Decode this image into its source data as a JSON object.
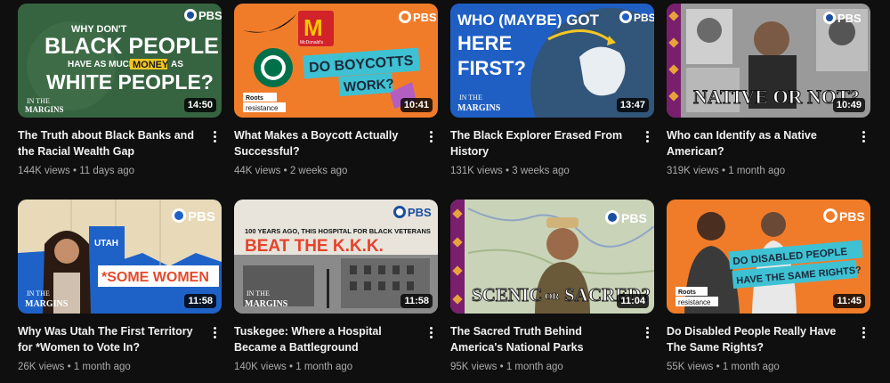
{
  "videos": [
    {
      "title": "The Truth about Black Banks and the Racial Wealth Gap",
      "info": "144K views • 11 days ago",
      "duration": "14:50",
      "thumb": {
        "pbs": "PBS",
        "line1": "WHY DON'T",
        "line2": "BLACK PEOPLE",
        "line3": "HAVE AS MUCH",
        "highlight": "MONEY",
        "line3b": "AS",
        "line4": "WHITE PEOPLE?",
        "brand1": "IN THE",
        "brand2": "MARGINS"
      }
    },
    {
      "title": "What Makes a Boycott Actually Successful?",
      "info": "44K views • 2 weeks ago",
      "duration": "10:41",
      "thumb": {
        "pbs": "PBS",
        "line1": "DO BOYCOTTS",
        "line2": "WORK?",
        "brand1": "Roots",
        "brand2": "resistance",
        "logo1": "McDonald's",
        "logo2": "STARBUCKS COFFEE"
      }
    },
    {
      "title": "The Black Explorer Erased From History",
      "info": "131K views • 3 weeks ago",
      "duration": "13:47",
      "thumb": {
        "pbs": "PBS",
        "line1": "WHO (MAYBE) GOT",
        "line2": "HERE",
        "line3": "FIRST?",
        "brand1": "IN THE",
        "brand2": "MARGINS"
      }
    },
    {
      "title": "Who can Identify as a Native American?",
      "info": "319K views • 1 month ago",
      "duration": "10:49",
      "thumb": {
        "pbs": "PBS",
        "line1": "NATIVE OR NOT?"
      }
    },
    {
      "title": "Why Was Utah The First Territory for *Women to Vote In?",
      "info": "26K views • 1 month ago",
      "duration": "11:58",
      "thumb": {
        "pbs": "PBS",
        "state": "UTAH",
        "line1": "*SOME WOMEN",
        "brand1": "IN THE",
        "brand2": "MARGINS"
      }
    },
    {
      "title": "Tuskegee: Where a Hospital Became a Battleground",
      "info": "140K views • 1 month ago",
      "duration": "11:58",
      "thumb": {
        "pbs": "PBS",
        "line1": "100 YEARS AGO, THIS HOSPITAL FOR BLACK VETERANS",
        "line2": "BEAT THE K.K.K.",
        "brand1": "IN THE",
        "brand2": "MARGINS"
      }
    },
    {
      "title": "The Sacred Truth Behind America's National Parks",
      "info": "95K views • 1 month ago",
      "duration": "11:04",
      "thumb": {
        "pbs": "PBS",
        "line1": "SCENIC",
        "line1b": "OR",
        "line2": "SACRED?"
      }
    },
    {
      "title": "Do Disabled People Really Have The Same Rights?",
      "info": "55K views • 1 month ago",
      "duration": "11:45",
      "thumb": {
        "pbs": "PBS",
        "line1": "DO DISABLED PEOPLE",
        "line2": "HAVE THE SAME RIGHTS?",
        "brand1": "Roots",
        "brand2": "resistance"
      }
    }
  ],
  "colors": {
    "background": "#0f0f0f",
    "title": "#f1f1f1",
    "meta": "#aaaaaa",
    "orange": "#f07c2a",
    "cyan": "#3ec1d3",
    "yellow": "#f3c623"
  },
  "icons": {
    "more": "vertical-ellipsis-icon",
    "pbs": "pbs-logo-icon"
  }
}
